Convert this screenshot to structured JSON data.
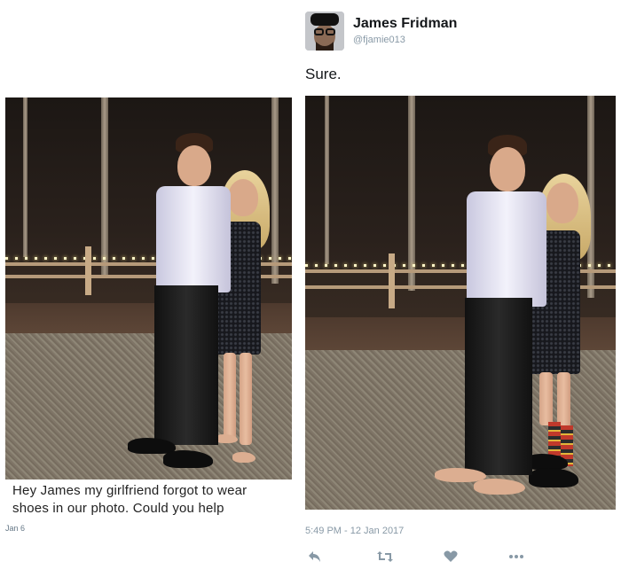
{
  "left_panel": {
    "photo_alt": "couple standing at night in front of fence with string lights",
    "caption": "Hey James my girlfriend forgot to wear shoes in our photo. Could you help",
    "date": "Jan 6"
  },
  "tweet": {
    "author_name": "James Fridman",
    "author_handle": "@fjamie013",
    "text": "Sure.",
    "timestamp": "5:49 PM - 12 Jan 2017",
    "photo_alt": "edited photo: man barefoot, woman wearing his shoes and socks"
  },
  "actions": [
    {
      "name": "reply",
      "icon": "reply-icon",
      "glyph": "↰"
    },
    {
      "name": "retweet",
      "icon": "retweet-icon",
      "glyph": "⇄"
    },
    {
      "name": "like",
      "icon": "heart-icon",
      "glyph": "♥"
    },
    {
      "name": "more",
      "icon": "more-icon",
      "glyph": "•••"
    }
  ],
  "colors": {
    "text": "#14171a",
    "secondary": "#8899a6"
  }
}
